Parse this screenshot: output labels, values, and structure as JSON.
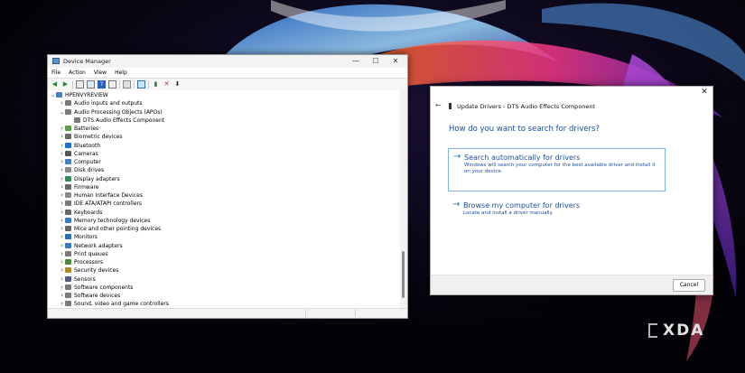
{
  "device_manager": {
    "title": "Device Manager",
    "controls": {
      "minimize": "—",
      "maximize": "☐",
      "close": "✕"
    },
    "menu": [
      "File",
      "Action",
      "View",
      "Help"
    ],
    "toolbar_icons": [
      "back-icon",
      "forward-icon",
      "properties-icon",
      "list-icon",
      "help-icon",
      "details-icon",
      "print-icon",
      "monitor-icon",
      "update-driver-icon",
      "uninstall-icon",
      "download-icon"
    ],
    "tree": [
      {
        "label": "HPENVYREVIEW",
        "depth": 0,
        "expanded": true,
        "icon": "computer-icon",
        "color": "#4a7fbf"
      },
      {
        "label": "Audio inputs and outputs",
        "depth": 1,
        "expanded": false,
        "icon": "speaker-icon",
        "color": "#7a7a7a"
      },
      {
        "label": "Audio Processing Objects (APOs)",
        "depth": 1,
        "expanded": true,
        "icon": "speaker-icon",
        "color": "#7a7a7a"
      },
      {
        "label": "DTS Audio Effects Component",
        "depth": 2,
        "leaf": true,
        "icon": "speaker-icon",
        "color": "#7a7a7a"
      },
      {
        "label": "Batteries",
        "depth": 1,
        "expanded": false,
        "icon": "battery-icon",
        "color": "#5aa04a"
      },
      {
        "label": "Biometric devices",
        "depth": 1,
        "expanded": false,
        "icon": "fingerprint-icon",
        "color": "#6a6a6a"
      },
      {
        "label": "Bluetooth",
        "depth": 1,
        "expanded": false,
        "icon": "bluetooth-icon",
        "color": "#1a6fd0"
      },
      {
        "label": "Cameras",
        "depth": 1,
        "expanded": false,
        "icon": "camera-icon",
        "color": "#555555"
      },
      {
        "label": "Computer",
        "depth": 1,
        "expanded": false,
        "icon": "computer-icon",
        "color": "#4a7fbf"
      },
      {
        "label": "Disk drives",
        "depth": 1,
        "expanded": false,
        "icon": "disk-icon",
        "color": "#8a8a8a"
      },
      {
        "label": "Display adapters",
        "depth": 1,
        "expanded": false,
        "icon": "display-icon",
        "color": "#3a8a5a"
      },
      {
        "label": "Firmware",
        "depth": 1,
        "expanded": false,
        "icon": "chip-icon",
        "color": "#6a6a6a"
      },
      {
        "label": "Human Interface Devices",
        "depth": 1,
        "expanded": false,
        "icon": "hid-icon",
        "color": "#8a8a8a"
      },
      {
        "label": "IDE ATA/ATAPI controllers",
        "depth": 1,
        "expanded": false,
        "icon": "controller-icon",
        "color": "#7a7a7a"
      },
      {
        "label": "Keyboards",
        "depth": 1,
        "expanded": false,
        "icon": "keyboard-icon",
        "color": "#6a6a6a"
      },
      {
        "label": "Memory technology devices",
        "depth": 1,
        "expanded": false,
        "icon": "memory-icon",
        "color": "#3a7ac0"
      },
      {
        "label": "Mice and other pointing devices",
        "depth": 1,
        "expanded": false,
        "icon": "mouse-icon",
        "color": "#6a6a6a"
      },
      {
        "label": "Monitors",
        "depth": 1,
        "expanded": false,
        "icon": "monitor-icon",
        "color": "#2f6fb0"
      },
      {
        "label": "Network adapters",
        "depth": 1,
        "expanded": false,
        "icon": "network-icon",
        "color": "#3a7ac0"
      },
      {
        "label": "Print queues",
        "depth": 1,
        "expanded": false,
        "icon": "printer-icon",
        "color": "#7a7a7a"
      },
      {
        "label": "Processors",
        "depth": 1,
        "expanded": false,
        "icon": "processor-icon",
        "color": "#4a8a3a"
      },
      {
        "label": "Security devices",
        "depth": 1,
        "expanded": false,
        "icon": "security-icon",
        "color": "#b08a2a"
      },
      {
        "label": "Sensors",
        "depth": 1,
        "expanded": false,
        "icon": "sensor-icon",
        "color": "#5a5a8a"
      },
      {
        "label": "Software components",
        "depth": 1,
        "expanded": false,
        "icon": "component-icon",
        "color": "#7a7a7a"
      },
      {
        "label": "Software devices",
        "depth": 1,
        "expanded": false,
        "icon": "component-icon",
        "color": "#7a7a7a"
      },
      {
        "label": "Sound, video and game controllers",
        "depth": 1,
        "expanded": false,
        "icon": "speaker-icon",
        "color": "#7a7a7a"
      }
    ]
  },
  "update_drivers": {
    "close": "✕",
    "back": "←",
    "title": "Update Drivers - DTS Audio Effects Component",
    "question": "How do you want to search for drivers?",
    "option_auto": {
      "arrow": "→",
      "head": "Search automatically for drivers",
      "desc": "Windows will search your computer for the best available driver and install it on your device."
    },
    "option_browse": {
      "arrow": "→",
      "head": "Browse my computer for drivers",
      "desc": "Locate and install a driver manually."
    },
    "cancel": "Cancel"
  },
  "watermark": {
    "text": "XDA"
  }
}
